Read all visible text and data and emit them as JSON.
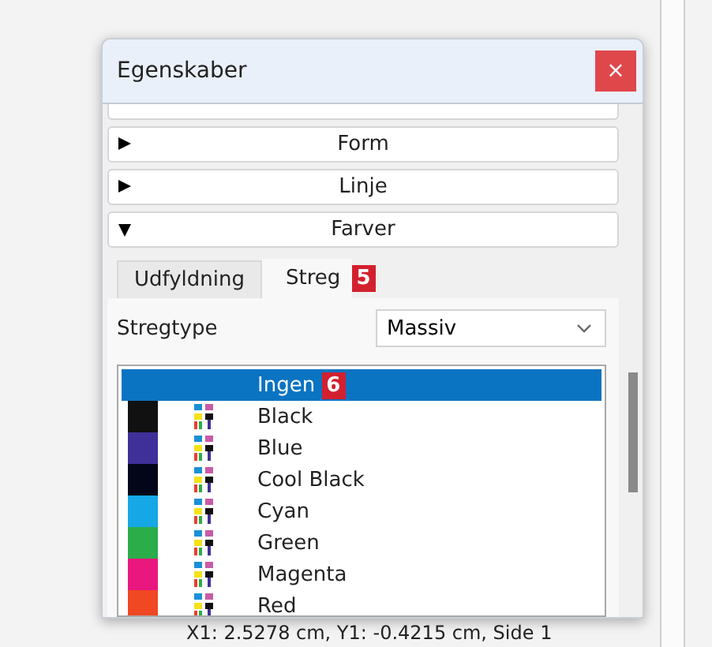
{
  "window": {
    "title": "Egenskaber",
    "close": "×"
  },
  "sections": [
    {
      "label": "Form",
      "expanded": false
    },
    {
      "label": "Linje",
      "expanded": false
    },
    {
      "label": "Farver",
      "expanded": true
    }
  ],
  "tabs": [
    {
      "label": "Udfyldning",
      "selected": false
    },
    {
      "label": "Streg",
      "selected": true,
      "badge": "5"
    }
  ],
  "stroke_type": {
    "label": "Stregtype",
    "value": "Massiv"
  },
  "colors": [
    {
      "name": "Ingen",
      "selected": true,
      "badge": "6"
    },
    {
      "name": "Black",
      "selected": false,
      "color": "#111111"
    },
    {
      "name": "Blue",
      "selected": false,
      "color": "#3f3099"
    },
    {
      "name": "Cool Black",
      "selected": false,
      "color": "#020618"
    },
    {
      "name": "Cyan",
      "selected": false,
      "color": "#16a7e6"
    },
    {
      "name": "Green",
      "selected": false,
      "color": "#2bad4a"
    },
    {
      "name": "Magenta",
      "selected": false,
      "color": "#ea177f"
    },
    {
      "name": "Red",
      "selected": false,
      "color": "#ef4823"
    }
  ],
  "status_bar": {
    "text": "X1: 2.5278 cm, Y1: -0.4215 cm, Side 1"
  }
}
